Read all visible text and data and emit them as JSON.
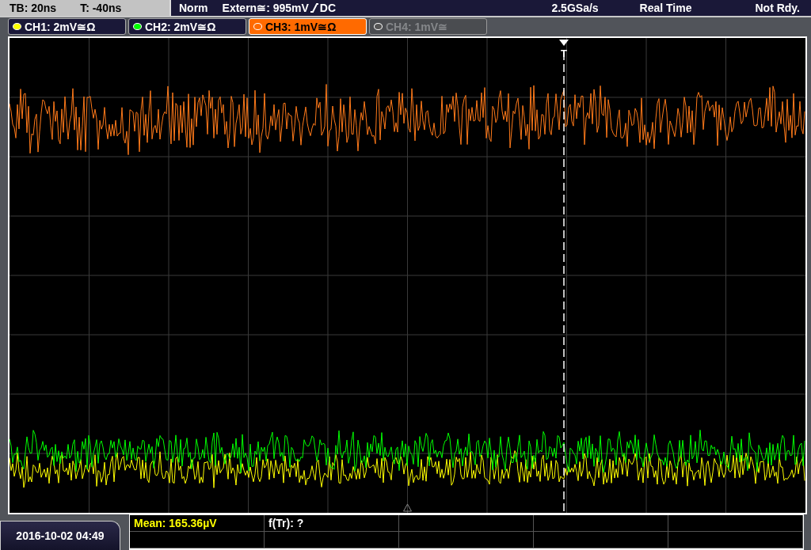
{
  "timebase": {
    "tb": "TB: 20ns",
    "t": "T: -40ns"
  },
  "trigger_bar": {
    "mode": "Norm",
    "source": "Extern≅: 995mV",
    "coupling": "DC",
    "sample_rate": "2.5GSa/s",
    "acquisition": "Real Time",
    "status": "Not Rdy."
  },
  "channels": [
    {
      "label": "CH1: 2mV≅Ω",
      "color": "#ffff00",
      "selected": false,
      "disabled": false
    },
    {
      "label": "CH2: 2mV≅Ω",
      "color": "#00ff00",
      "selected": false,
      "disabled": false
    },
    {
      "label": "CH3: 1mV≅Ω",
      "color": "#ff6a00",
      "selected": true,
      "disabled": false
    },
    {
      "label": "CH4: 1mV≅",
      "color": "#555555",
      "selected": false,
      "disabled": true
    }
  ],
  "trigger_marker": {
    "label": "T"
  },
  "date_time": "2016-10-02 04:49",
  "measurements": [
    {
      "text": "Mean: 165.36µV",
      "color": "#ffff00"
    },
    {
      "text": "f(Tr): ?",
      "color": "#ffffff"
    }
  ]
}
